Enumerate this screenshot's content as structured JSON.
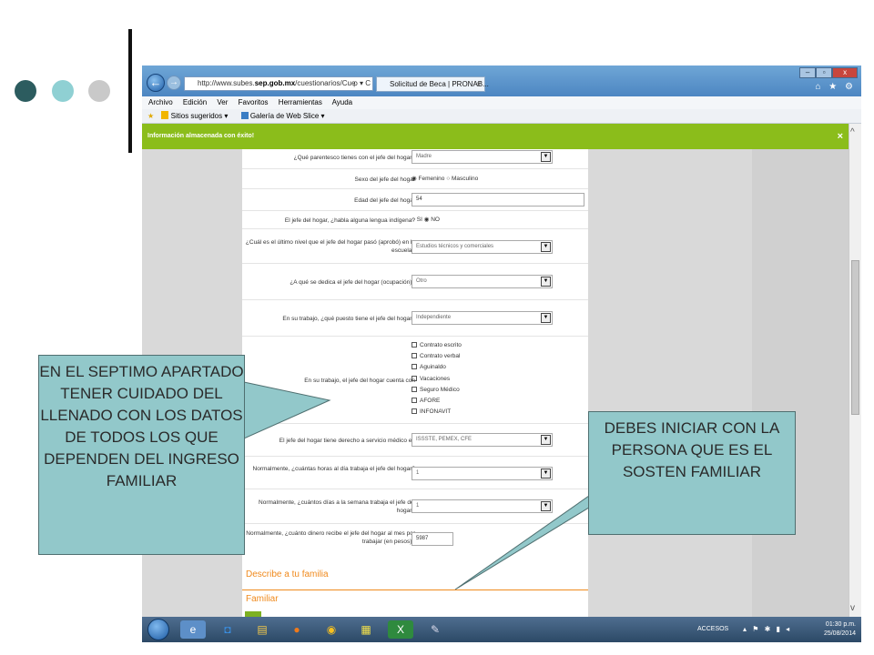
{
  "browser": {
    "address_url_prefix": "http://www.subes.",
    "address_url_domain": "sep.gob.mx",
    "address_url_path": "/cuestionarios/Cue",
    "address_tools": "ρ ▾ C",
    "tab_title": "Solicitud de Beca | PRONAB...",
    "tab_close": "×",
    "window_controls": {
      "minimize": "–",
      "restore": "▫",
      "close": "x"
    },
    "toolbar_icons": "⌂ ★ ⚙",
    "menu": [
      "Archivo",
      "Edición",
      "Ver",
      "Favoritos",
      "Herramientas",
      "Ayuda"
    ],
    "favorites": [
      "Sitios sugeridos ▾",
      "Galería de Web Slice ▾"
    ]
  },
  "notification": {
    "text": "Información almacenada con éxito!",
    "close": "×"
  },
  "form": {
    "parentesco": {
      "label": "¿Qué parentesco tienes con el jefe del hogar?",
      "value": "Madre"
    },
    "sexo": {
      "label": "Sexo del jefe del hogar",
      "option1": "Femenino",
      "option2": "Masculino"
    },
    "edad": {
      "label": "Edad del jefe del hogar",
      "value": "54"
    },
    "lengua": {
      "label": "El jefe del hogar, ¿habla alguna lengua indígena?",
      "option1": "SI",
      "option2": "NO"
    },
    "nivel": {
      "label": "¿Cuál es el último nivel que el jefe del hogar pasó (aprobó) en la escuela?",
      "value": "Estudios técnicos y comerciales"
    },
    "ocupacion": {
      "label": "¿A qué se dedica el jefe del hogar (ocupación)?",
      "value": "Otro"
    },
    "puesto": {
      "label": "En su trabajo, ¿qué puesto tiene el jefe del hogar?",
      "value": "Independiente"
    },
    "prestaciones": {
      "label": "En su trabajo, el jefe del hogar cuenta con",
      "options": [
        "Contrato escrito",
        "Contrato verbal",
        "Aguinaldo",
        "Vacaciones",
        "Seguro Médico",
        "AFORE",
        "INFONAVIT"
      ]
    },
    "servicio": {
      "label": "El jefe del hogar tiene derecho a servicio médico en",
      "value": "ISSSTE, PEMEX, CFE"
    },
    "horas": {
      "label": "Normalmente, ¿cuántas horas al día trabaja el jefe del hogar?",
      "value": "1"
    },
    "dias": {
      "label": "Normalmente, ¿cuántos días a la semana trabaja el jefe del hogar?",
      "value": "1"
    },
    "dinero": {
      "label": "Normalmente, ¿cuánto dinero recibe el jefe del hogar al mes por trabajar (en pesos)?",
      "value": "5987"
    },
    "section_title": "Describe a tu familia",
    "section_sub": "Familiar"
  },
  "taskbar": {
    "accesos": "ACCESOS",
    "time": "01:30 p.m.",
    "date": "25/08/2014"
  },
  "callouts": {
    "left": "EN EL SEPTIMO APARTADO TENER CUIDADO DEL LLENADO CON LOS DATOS DE TODOS LOS QUE DEPENDEN DEL INGRESO FAMILIAR",
    "right": "DEBES INICIAR CON LA PERSONA QUE ES EL SOSTEN FAMILIAR"
  },
  "colors": {
    "notification_green": "#8bbd1b",
    "section_orange": "#f08a1d",
    "callout_teal": "#92c8ca"
  }
}
